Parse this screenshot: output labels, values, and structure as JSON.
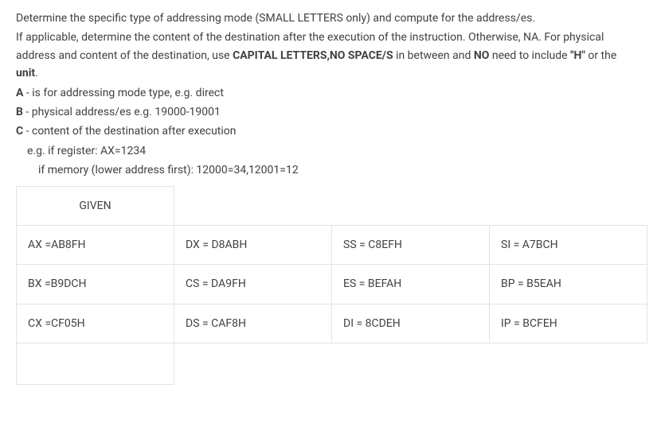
{
  "instructions": {
    "line1": "Determine the specific type of addressing mode (SMALL LETTERS only) and compute for the address/es.",
    "line2_pre": "If applicable, determine the content of the destination after the execution of the instruction. Otherwise, NA. For physical address and content of the destination, use ",
    "line2_b1": "CAPITAL LETTERS,NO SPACE/S",
    "line2_mid": " in between and ",
    "line2_b2": "NO",
    "line2_post": " need to include ",
    "line2_b3": "\"H\"",
    "line2_post2": " or the ",
    "line2_b4": "unit",
    "line2_end": ".",
    "lineA_b": "A",
    "lineA": " - is for addressing mode type, e.g. direct",
    "lineB_b": "B",
    "lineB": " - physical address/es e.g. 19000-19001",
    "lineC_b": "C",
    "lineC": " - content of the destination after execution",
    "lineC_eg1": "e.g. if register:  AX=1234",
    "lineC_eg2": "if memory (lower address first):   12000=34,12001=12"
  },
  "table": {
    "header": "GIVEN",
    "rows": [
      [
        "AX =AB8FH",
        "DX = D8ABH",
        "SS = C8EFH",
        "SI = A7BCH"
      ],
      [
        "BX =B9DCH",
        "CS = DA9FH",
        "ES = BEFAH",
        "BP = B5EAH"
      ],
      [
        "CX =CF05H",
        "DS = CAF8H",
        "DI = 8CDEH",
        "IP = BCFEH"
      ]
    ]
  },
  "chart_data": {
    "type": "table",
    "title": "GIVEN",
    "registers": {
      "AX": "AB8FH",
      "BX": "B9DCH",
      "CX": "CF05H",
      "DX": "D8ABH",
      "CS": "DA9FH",
      "DS": "CAF8H",
      "SS": "C8EFH",
      "ES": "BEFAH",
      "DI": "8CDEH",
      "SI": "A7BCH",
      "BP": "B5EAH",
      "IP": "BCFEH"
    }
  }
}
